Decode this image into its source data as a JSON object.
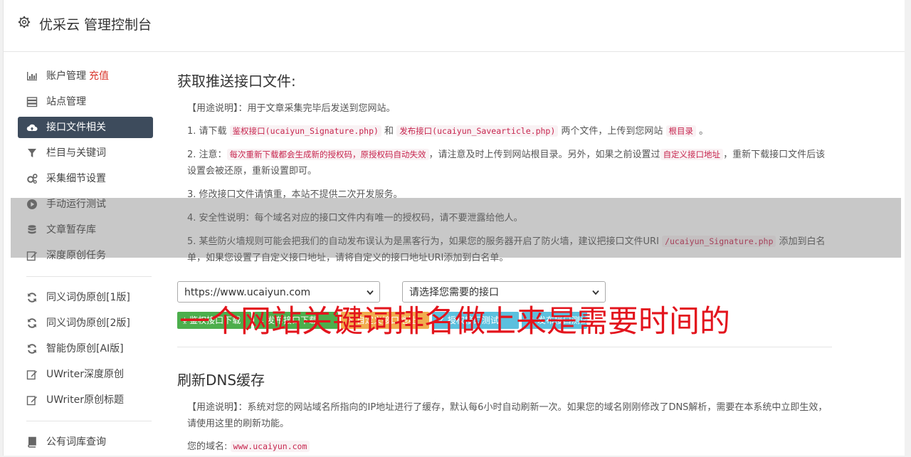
{
  "header": {
    "title": "优采云 管理控制台"
  },
  "sidebar": {
    "items": [
      {
        "label": "账户管理",
        "extra": "充值",
        "icon": "bar-chart-icon"
      },
      {
        "label": "站点管理",
        "icon": "server-icon"
      },
      {
        "label": "接口文件相关",
        "icon": "cloud-upload-icon",
        "active": true
      },
      {
        "label": "栏目与关键词",
        "icon": "filter-icon"
      },
      {
        "label": "采集细节设置",
        "icon": "cogs-icon"
      },
      {
        "label": "手动运行测试",
        "icon": "play-circle-icon"
      },
      {
        "label": "文章暂存库",
        "icon": "database-icon"
      },
      {
        "label": "深度原创任务",
        "icon": "edit-icon"
      }
    ],
    "group2": [
      {
        "label": "同义词伪原创[1版]",
        "icon": "refresh-icon"
      },
      {
        "label": "同义词伪原创[2版]",
        "icon": "refresh-icon"
      },
      {
        "label": "智能伪原创[AI版]",
        "icon": "refresh-icon"
      },
      {
        "label": "UWriter深度原创",
        "icon": "edit-icon"
      },
      {
        "label": "UWriter原创标题",
        "icon": "edit-icon"
      }
    ],
    "group3": [
      {
        "label": "公有词库查询",
        "icon": "book-icon"
      }
    ]
  },
  "main": {
    "section1": {
      "title": "获取推送接口文件:",
      "usage": "【用途说明】：用于文章采集完毕后发送到您网站。",
      "p1_a": "1. 请下载 ",
      "p1_code1": "鉴权接口(ucaiyun_Signature.php)",
      "p1_b": " 和 ",
      "p1_code2": "发布接口(ucaiyun_Savearticle.php)",
      "p1_c": " 两个文件，上传到您网站 ",
      "p1_code3": "根目录",
      "p1_d": " 。",
      "p2_a": "2. 注意：",
      "p2_code1": "每次重新下载都会生成新的授权码，原授权码自动失效",
      "p2_b": "，请注意及时上传到网站根目录。另外，如果之前设置过",
      "p2_code2": "自定义接口地址",
      "p2_c": "，重新下载接口文件后该设置会被还原，重新设置即可。",
      "p3": "3. 修改接口文件请慎重，本站不提供二次开发服务。",
      "p4": "4. 安全性说明：每个域名对应的接口文件内有唯一的授权码，请不要泄露给他人。",
      "p5_a": "5. 某些防火墙规则可能会把我们的自动发布误认为是黑客行为，如果您的服务器开启了防火墙，建议把接口文件URI ",
      "p5_code": "/ucaiyun_Signature.php",
      "p5_b": " 添加到白名单，如果您设置了自定义接口地址，请将自定义的接口地址URI添加到白名单。",
      "site_select": "https://www.ucaiyun.com",
      "api_select": "请选择您需要的接口",
      "buttons": [
        {
          "label": "鉴权接口下载",
          "color": "#4cae4c"
        },
        {
          "label": "发布接口下载",
          "color": "#4cae4c"
        },
        {
          "label": "自定义接口地址",
          "color": "#f0ad4e"
        },
        {
          "label": "授权接口测试",
          "color": "#5bc0de"
        },
        {
          "label": "发布接口测试",
          "color": "#5bc0de"
        }
      ]
    },
    "section2": {
      "title": "刷新DNS缓存",
      "usage": "【用途说明】：系统对您的网站域名所指向的IP地址进行了缓存，默认每6小时自动刷新一次。如果您的域名刚刚修改了DNS解析，需要在本系统中立即生效，请使用这里的刷新功能。",
      "domain_label": "您的域名:",
      "domain_value": "www.ucaiyun.com"
    }
  },
  "overlay": {
    "title": "一个网站关键词排名做上来是需要时间的"
  }
}
